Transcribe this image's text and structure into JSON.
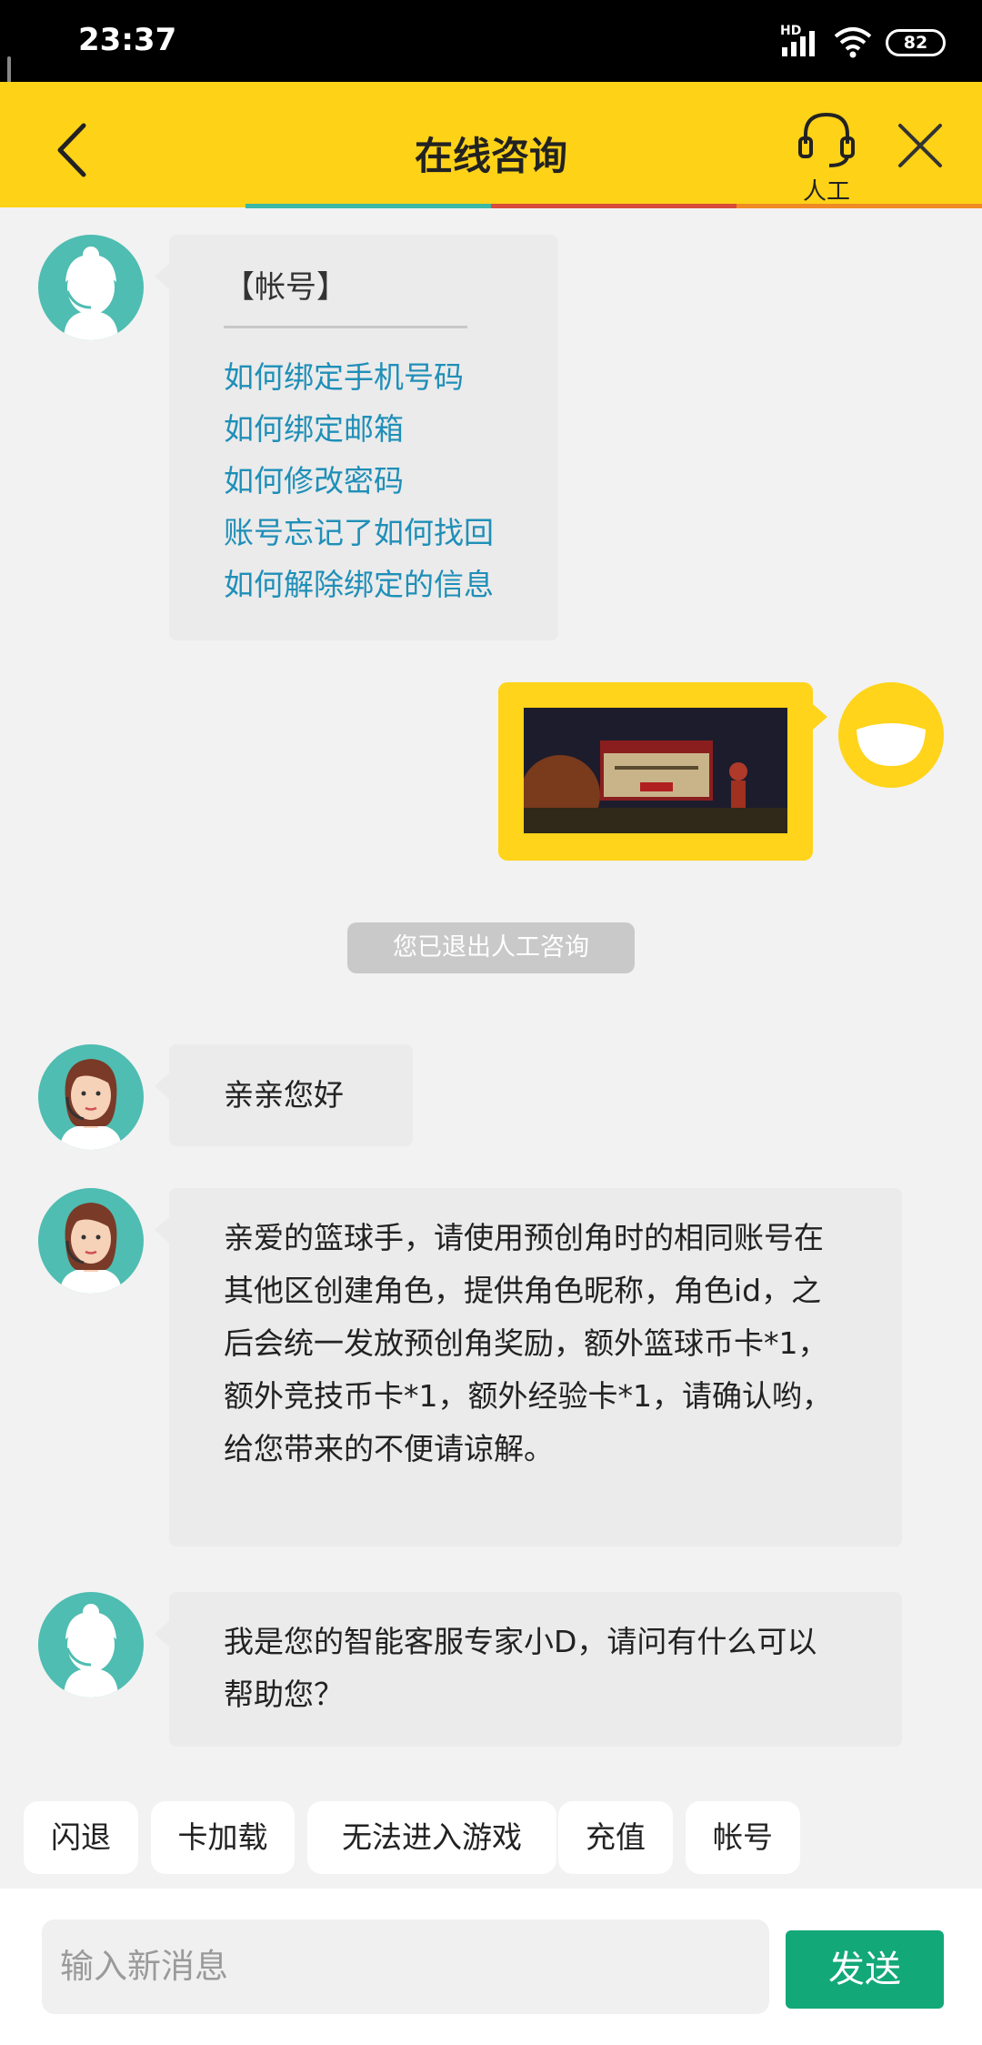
{
  "status_bar": {
    "time": "23:37",
    "network": "HD",
    "battery": "82"
  },
  "header": {
    "title": "在线咨询",
    "agent_label": "人工"
  },
  "messages": {
    "menu": {
      "heading": "【帐号】",
      "links": [
        "如何绑定手机号码",
        "如何绑定邮箱",
        "如何修改密码",
        "账号忘记了如何找回",
        "如何解除绑定的信息"
      ]
    },
    "system_notice": "您已退出人工咨询",
    "agent_greeting": "亲亲您好",
    "agent_reply": "亲爱的篮球手，请使用预创角时的相同账号在其他区创建角色，提供角色昵称，角色id，之后会统一发放预创角奖励，额外篮球币卡*1，额外竞技币卡*1，额外经验卡*1，请确认哟，给您带来的不便请谅解。",
    "bot_intro": "我是您的智能客服专家小D，请问有什么可以帮助您？"
  },
  "quick_replies": [
    "闪退",
    "卡加载",
    "无法进入游戏",
    "充值",
    "帐号"
  ],
  "composer": {
    "placeholder": "输入新消息",
    "send_label": "发送"
  },
  "colors": {
    "header": "#fed217",
    "link": "#1f8fb8",
    "send": "#12a877",
    "avatar_bg": "#4fbdb1",
    "user_bubble": "#ffd41a"
  }
}
